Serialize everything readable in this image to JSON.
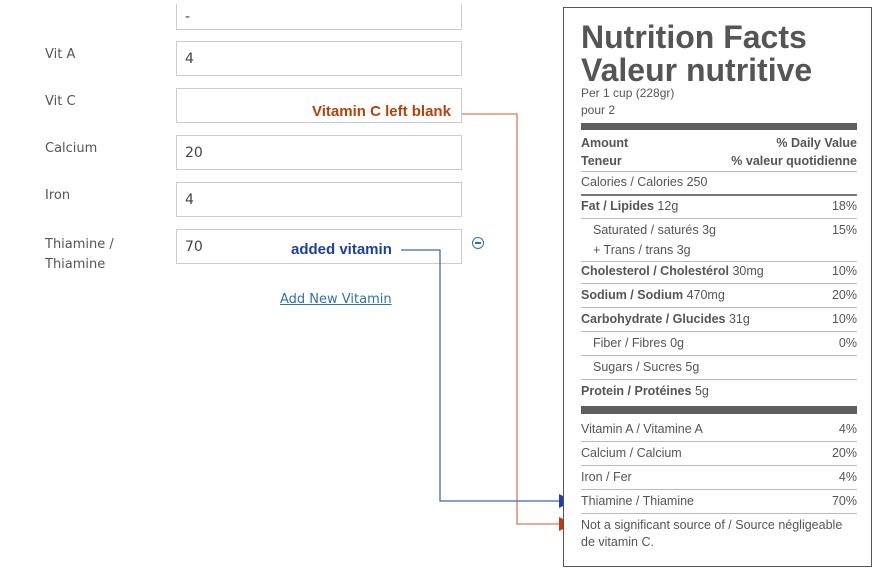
{
  "form": {
    "top_value": "-",
    "rows": [
      {
        "label": "Vit A",
        "value": "4"
      },
      {
        "label": "Vit C",
        "value": ""
      },
      {
        "label": "Calcium",
        "value": "20"
      },
      {
        "label": "Iron",
        "value": "4"
      },
      {
        "label_line1": "Thiamine /",
        "label_line2": "Thiamine",
        "value": "70"
      }
    ],
    "add_new_vitamin": "Add New Vitamin"
  },
  "annotations": {
    "vitamin_c": "Vitamin C left blank",
    "added": "added vitamin"
  },
  "nutrition": {
    "title1": "Nutrition Facts",
    "title2": "Valeur nutritive",
    "per1": "Per 1 cup (228gr)",
    "per2": "pour 2",
    "amount": "Amount",
    "teneur": "Teneur",
    "dv_en": "% Daily Value",
    "dv_fr": "% valeur quotidienne",
    "calories": "Calories / Calories 250",
    "fat_label": "Fat / Lipides",
    "fat_amt": "12g",
    "fat_dv": "18%",
    "sat": "Saturated / saturés 3g",
    "sat_dv": "15%",
    "trans": "+ Trans / trans 3g",
    "chol_label": "Cholesterol / Cholestérol",
    "chol_amt": "30mg",
    "chol_dv": "10%",
    "sod_label": "Sodium / Sodium",
    "sod_amt": "470mg",
    "sod_dv": "20%",
    "carb_label": "Carbohydrate / Glucides",
    "carb_amt": "31g",
    "carb_dv": "10%",
    "fiber": "Fiber / Fibres 0g",
    "fiber_dv": "0%",
    "sugars": "Sugars / Sucres 5g",
    "prot_label": "Protein / Protéines",
    "prot_amt": "5g",
    "vita": "Vitamin A / Vitamine A",
    "vita_dv": "4%",
    "calc": "Calcium / Calcium",
    "calc_dv": "20%",
    "iron": "Iron / Fer",
    "iron_dv": "4%",
    "thia": "Thiamine / Thiamine",
    "thia_dv": "70%",
    "note1": "Not a significant source of / Source négligeable",
    "note2": "de vitamin C."
  },
  "colors": {
    "red_annotation": "#b5410d",
    "blue_annotation": "#1f3fa0",
    "link": "#2f72a8"
  },
  "icons": {
    "remove": "minus-circle-icon"
  }
}
